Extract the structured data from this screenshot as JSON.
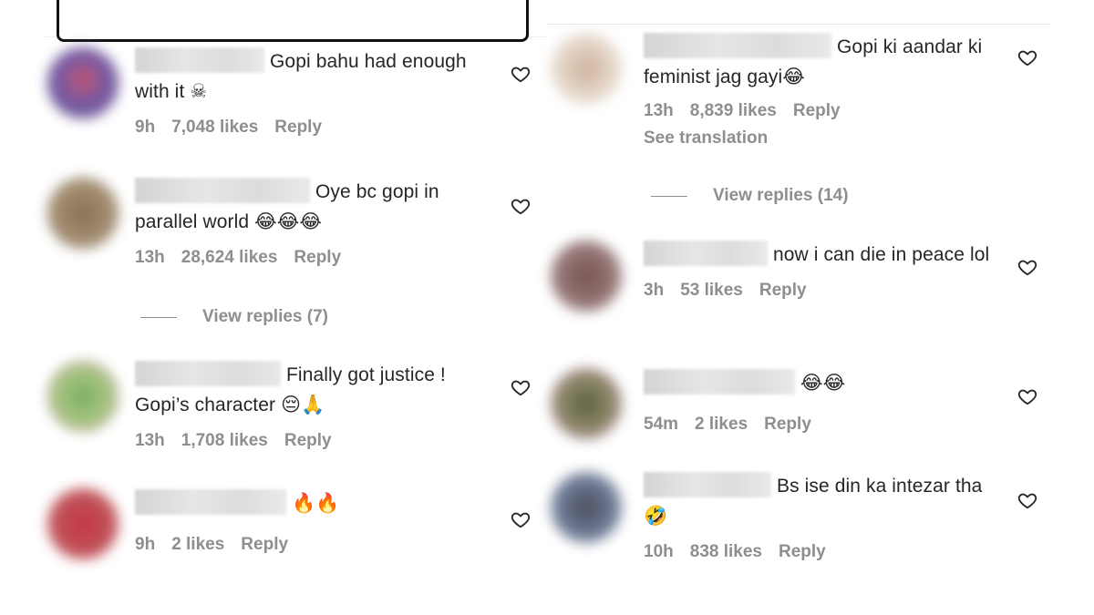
{
  "left": {
    "comments": [
      {
        "text": "Gopi bahu had enough with it",
        "emoji": "☠",
        "time": "9h",
        "likes": "7,048 likes",
        "reply": "Reply",
        "avatar_color": "#8a5a9e"
      },
      {
        "text": "Oye bc gopi in parallel world",
        "emoji": "😂😂😂",
        "time": "13h",
        "likes": "28,624 likes",
        "reply": "Reply",
        "avatar_color": "#8a7355",
        "view_replies": "View replies (7)"
      },
      {
        "text": "Finally got justice ! Gopi’s character",
        "emoji": "😔🙏",
        "time": "13h",
        "likes": "1,708 likes",
        "reply": "Reply",
        "avatar_color": "#7aa860"
      },
      {
        "text": "",
        "emoji": "🔥🔥",
        "time": "9h",
        "likes": "2 likes",
        "reply": "Reply",
        "avatar_color": "#b83a3f"
      }
    ]
  },
  "right": {
    "comments": [
      {
        "text": "Gopi ki aandar ki feminist jag gayi",
        "emoji": "😂",
        "time": "13h",
        "likes": "8,839 likes",
        "reply": "Reply",
        "translation": "See translation",
        "avatar_color": "#d8c8b8",
        "view_replies": "View replies (14)"
      },
      {
        "text": "now i can die in peace lol",
        "emoji": "",
        "time": "3h",
        "likes": "53 likes",
        "reply": "Reply",
        "avatar_color": "#7d5a55"
      },
      {
        "text": "",
        "emoji": "😂😂",
        "time": "54m",
        "likes": "2 likes",
        "reply": "Reply",
        "avatar_color": "#5a5a40"
      },
      {
        "text": "Bs ise din ka intezar tha",
        "emoji": "🤣",
        "time": "10h",
        "likes": "838 likes",
        "reply": "Reply",
        "avatar_color": "#4a5570"
      }
    ]
  },
  "icons": {
    "like": "heart-outline-icon"
  }
}
